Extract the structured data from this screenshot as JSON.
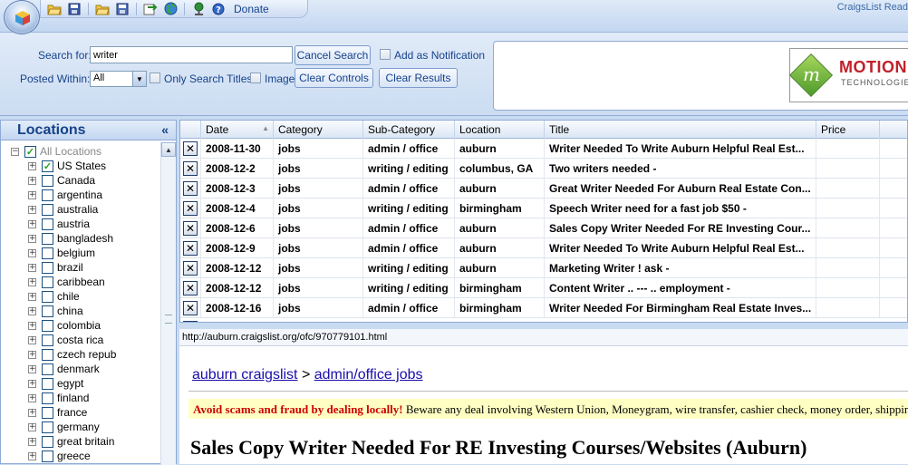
{
  "app": {
    "title": "CraigsList Read",
    "donate_label": "Donate"
  },
  "toolbar": {
    "icons": [
      "open-folder-icon",
      "save-disk-icon",
      "open-file-icon",
      "floppy-save-icon",
      "export-icon",
      "globe-icon",
      "network-icon",
      "help-icon"
    ]
  },
  "search": {
    "search_for_label": "Search for:",
    "search_value": "writer",
    "cancel_label": "Cancel Search",
    "notify_label": "Add as Notification",
    "posted_within_label": "Posted Within:",
    "posted_within_value": "All",
    "only_titles_label": "Only Search Titles",
    "image_label": "Image",
    "clear_controls_label": "Clear Controls",
    "clear_results_label": "Clear Results"
  },
  "ad": {
    "brand": "MOTION",
    "sub": "TECHNOLOGIES",
    "mark": "m"
  },
  "locations": {
    "title": "Locations",
    "collapse": "«",
    "root": "All Locations",
    "items": [
      {
        "label": "US States",
        "checked": true
      },
      {
        "label": "Canada",
        "checked": false
      },
      {
        "label": "argentina",
        "checked": false
      },
      {
        "label": "australia",
        "checked": false
      },
      {
        "label": "austria",
        "checked": false
      },
      {
        "label": "bangladesh",
        "checked": false
      },
      {
        "label": "belgium",
        "checked": false
      },
      {
        "label": "brazil",
        "checked": false
      },
      {
        "label": "caribbean",
        "checked": false
      },
      {
        "label": "chile",
        "checked": false
      },
      {
        "label": "china",
        "checked": false
      },
      {
        "label": "colombia",
        "checked": false
      },
      {
        "label": "costa rica",
        "checked": false
      },
      {
        "label": "czech repub",
        "checked": false
      },
      {
        "label": "denmark",
        "checked": false
      },
      {
        "label": "egypt",
        "checked": false
      },
      {
        "label": "finland",
        "checked": false
      },
      {
        "label": "france",
        "checked": false
      },
      {
        "label": "germany",
        "checked": false
      },
      {
        "label": "great britain",
        "checked": false
      },
      {
        "label": "greece",
        "checked": false
      }
    ]
  },
  "grid": {
    "headers": [
      "Date",
      "Category",
      "Sub-Category",
      "Location",
      "Title",
      "Price"
    ],
    "rows": [
      {
        "date": "2008-11-30",
        "category": "jobs",
        "subcategory": "admin / office",
        "location": "auburn",
        "title": "Writer Needed To Write Auburn Helpful Real Est...",
        "price": ""
      },
      {
        "date": "2008-12-2",
        "category": "jobs",
        "subcategory": "writing / editing",
        "location": "columbus, GA",
        "title": "Two writers needed -",
        "price": ""
      },
      {
        "date": "2008-12-3",
        "category": "jobs",
        "subcategory": "admin / office",
        "location": "auburn",
        "title": "Great Writer Needed For Auburn Real Estate Con...",
        "price": ""
      },
      {
        "date": "2008-12-4",
        "category": "jobs",
        "subcategory": "writing / editing",
        "location": "birmingham",
        "title": "Speech Writer need for a fast job $50 -",
        "price": ""
      },
      {
        "date": "2008-12-6",
        "category": "jobs",
        "subcategory": "admin / office",
        "location": "auburn",
        "title": "Sales Copy Writer Needed For RE Investing Cour...",
        "price": ""
      },
      {
        "date": "2008-12-9",
        "category": "jobs",
        "subcategory": "admin / office",
        "location": "auburn",
        "title": "Writer Needed To Write Auburn Helpful Real Est...",
        "price": ""
      },
      {
        "date": "2008-12-12",
        "category": "jobs",
        "subcategory": "writing / editing",
        "location": "auburn",
        "title": "Marketing Writer ! ask  -",
        "price": ""
      },
      {
        "date": "2008-12-12",
        "category": "jobs",
        "subcategory": "writing / editing",
        "location": "birmingham",
        "title": "Content Writer .. --- .. employment  -",
        "price": ""
      },
      {
        "date": "2008-12-16",
        "category": "jobs",
        "subcategory": "admin / office",
        "location": "birmingham",
        "title": "Writer Needed For Birmingham Real Estate Inves...",
        "price": ""
      }
    ]
  },
  "browser": {
    "url": "http://auburn.craigslist.org/ofc/970779101.html",
    "crumb_site": "auburn craigslist",
    "crumb_sep": " > ",
    "crumb_section": "admin/office jobs",
    "warning_bold": "Avoid scams and fraud by dealing locally!",
    "warning_text": " Beware any deal involving Western Union, Moneygram, wire transfer, cashier check, money order, shipping",
    "post_title": "Sales Copy Writer Needed For RE Investing Courses/Websites (Auburn)"
  }
}
